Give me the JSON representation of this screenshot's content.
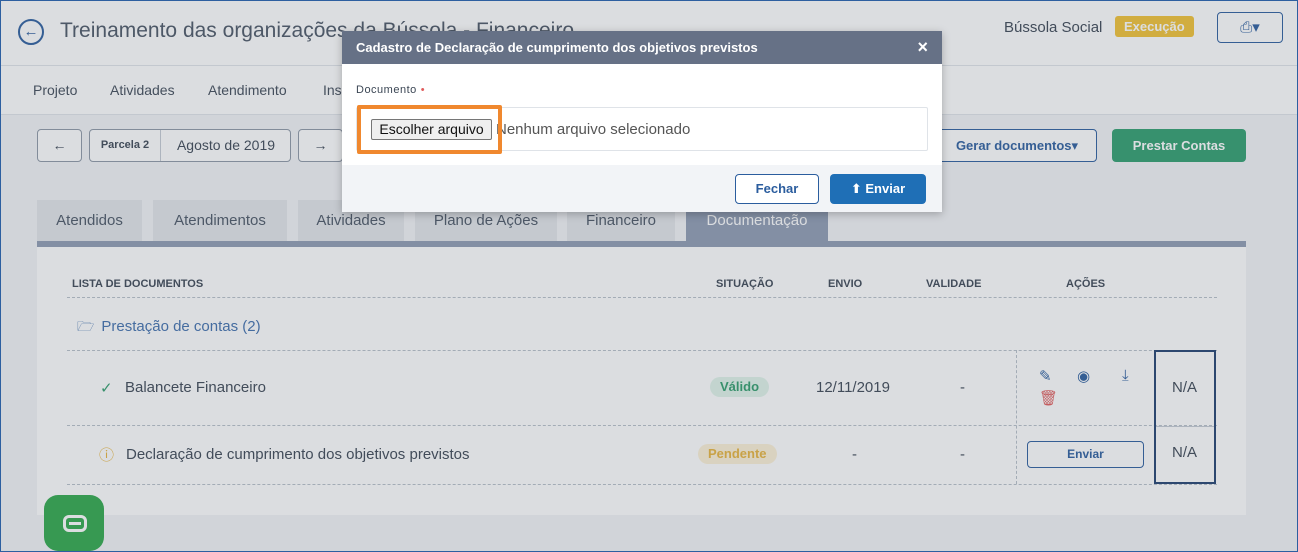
{
  "header": {
    "title": "Treinamento das organizações da Bússola - Financeiro",
    "org_name": "Bússola Social",
    "status": "Execução",
    "print_icon": "printer-icon"
  },
  "nav": {
    "items": [
      "Projeto",
      "Atividades",
      "Atendimento",
      "Ins"
    ]
  },
  "toolbar": {
    "prev": "←",
    "next": "→",
    "parcela_label": "Parcela 2",
    "parcela_value": "Agosto de 2019",
    "gerar": "Gerar documentos▾",
    "prestar": "Prestar Contas"
  },
  "tabs": [
    {
      "label": "Atendidos",
      "active": false
    },
    {
      "label": "Atendimentos",
      "active": false
    },
    {
      "label": "Atividades",
      "active": false
    },
    {
      "label": "Plano de Ações",
      "active": false
    },
    {
      "label": "Financeiro",
      "active": false
    },
    {
      "label": "Documentação",
      "active": true
    }
  ],
  "table": {
    "headers": {
      "lista": "LISTA DE DOCUMENTOS",
      "situacao": "SITUAÇÃO",
      "envio": "ENVIO",
      "validade": "VALIDADE",
      "acoes": "AÇÕES"
    },
    "folder": "Prestação de contas (2)",
    "rows": [
      {
        "name": "Balancete Financeiro",
        "status": "Válido",
        "envio": "12/11/2019",
        "validade": "-",
        "extra": "N/A"
      },
      {
        "name": "Declaração de cumprimento dos objetivos previstos",
        "status": "Pendente",
        "envio": "-",
        "validade": "-",
        "action": "Enviar",
        "extra": "N/A"
      }
    ]
  },
  "modal": {
    "title": "Cadastro de Declaração de cumprimento dos objetivos previstos",
    "close": "×",
    "field_label": "Documento",
    "required_mark": "•",
    "file_button": "Escolher arquivo",
    "file_status": "Nenhum arquivo selecionado",
    "cancel": "Fechar",
    "submit": "Enviar"
  },
  "colors": {
    "primary": "#2b5d9e",
    "success": "#2e9e6e",
    "warning": "#f2c233",
    "highlight": "#f0882e"
  }
}
